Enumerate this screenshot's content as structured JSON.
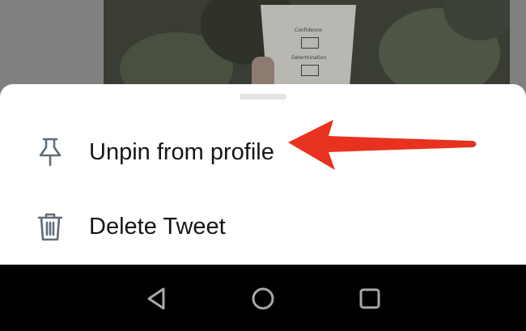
{
  "colors": {
    "sheet_bg": "#ffffff",
    "text": "#161616",
    "icon": "#5f6d79",
    "arrow": "#e8321f",
    "navbar_bg": "#000000",
    "nav_icon": "#a8a8a8"
  },
  "background": {
    "cup_label_top": "Confidence",
    "cup_label_bottom": "Determination"
  },
  "sheet": {
    "items": [
      {
        "label": "Unpin from profile",
        "icon": "pin-icon"
      },
      {
        "label": "Delete Tweet",
        "icon": "trash-icon"
      }
    ]
  },
  "navbar": {
    "buttons": [
      {
        "icon": "back-triangle-icon"
      },
      {
        "icon": "home-circle-icon"
      },
      {
        "icon": "recents-square-icon"
      }
    ]
  }
}
